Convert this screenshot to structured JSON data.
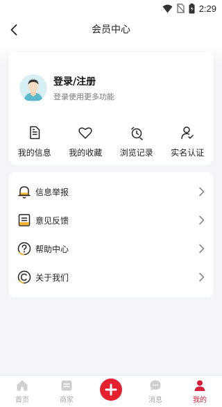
{
  "status_bar": {
    "time": "2:29",
    "icons": [
      "wifi-icon",
      "no-sim-icon",
      "battery-icon"
    ]
  },
  "header": {
    "back_icon": "chevron-left-icon",
    "title": "会员中心"
  },
  "profile": {
    "title": "登录/注册",
    "subtitle": "登录使用更多功能",
    "avatar_icon": "default-avatar-icon"
  },
  "quick_actions": [
    {
      "label": "我的信息",
      "icon": "document-icon"
    },
    {
      "label": "我的收藏",
      "icon": "heart-icon"
    },
    {
      "label": "浏览记录",
      "icon": "history-icon"
    },
    {
      "label": "实名认证",
      "icon": "user-verify-icon"
    }
  ],
  "menu": [
    {
      "label": "信息举报",
      "icon": "bell-icon"
    },
    {
      "label": "意见反馈",
      "icon": "feedback-icon"
    },
    {
      "label": "帮助中心",
      "icon": "question-icon"
    },
    {
      "label": "关于我们",
      "icon": "copyright-icon"
    }
  ],
  "tabbar": {
    "items": [
      {
        "label": "首页",
        "icon": "home-icon",
        "active": false
      },
      {
        "label": "商家",
        "icon": "store-icon",
        "active": false
      },
      {
        "label": "消息",
        "icon": "message-icon",
        "active": false
      },
      {
        "label": "我的",
        "icon": "person-icon",
        "active": true
      }
    ],
    "post_icon": "plus-icon"
  },
  "colors": {
    "accent": "#e5202f",
    "active_tab": "#d81e3a",
    "background": "#f4f5f8",
    "inactive_tab": "#aaaaaa"
  }
}
